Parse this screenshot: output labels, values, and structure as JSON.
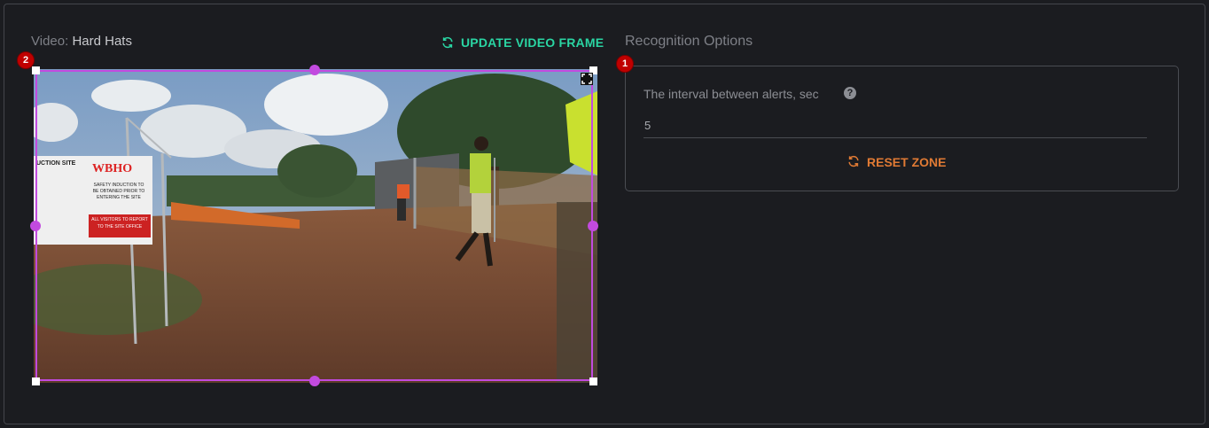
{
  "video": {
    "label_prefix": "Video:",
    "name": "Hard Hats",
    "update_label": "UPDATE VIDEO FRAME",
    "zone_badge": "2",
    "sign_brand": "WBHO",
    "sign_heading": "UCTION SITE",
    "sign_note": "SAFETY INDUCTION TO BE OBTAINED PRIOR TO ENTERING THE SITE",
    "sign_visitors": "ALL VISITORS TO REPORT TO THE SITE OFFICE"
  },
  "recognition": {
    "title": "Recognition Options",
    "badge": "1",
    "interval_label": "The interval between alerts, sec",
    "interval_value": "5",
    "reset_label": "RESET ZONE"
  },
  "colors": {
    "accent_green": "#2ad5a3",
    "accent_orange": "#e07a34",
    "zone_purple": "#c24adf",
    "badge_red": "#c00000"
  },
  "icons": [
    "refresh-icon",
    "help-icon",
    "expand-icon"
  ]
}
